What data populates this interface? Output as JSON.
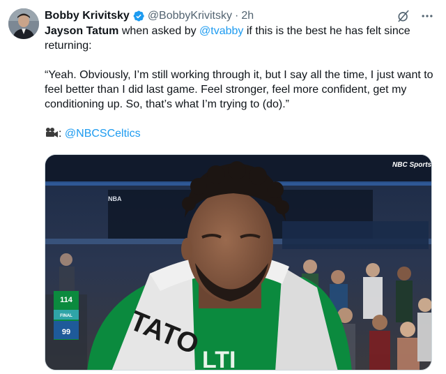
{
  "author": {
    "display_name": "Bobby Krivitsky",
    "handle": "@BobbyKrivitsky",
    "separator": "·",
    "time": "2h"
  },
  "tweet": {
    "line1_name": "Jayson Tatum",
    "line1_mid": " when asked by ",
    "line1_mention": "@tvabby",
    "line1_end": " if this is the best he has felt since returning:",
    "quote": "“Yeah. Obviously, I’m still working through it, but I say all the time, I just want to feel better than I did last game. Feel stronger, feel more confident, get my conditioning up. So, that’s what I’m trying to (do).”",
    "credit_suffix": ":",
    "credit_mention": "@NBCSCeltics"
  },
  "media": {
    "network_logo": "NBC Sports BOSTON",
    "banner_text": "NBA",
    "score_top": "114",
    "score_status": "FINAL",
    "score_bottom": "99",
    "towel_text": "TATO",
    "shirt_text": "LTI"
  },
  "icons": {
    "verified": "verified-badge-icon",
    "grok": "grok-icon",
    "more": "more-icon",
    "camera": "video-camera-icon"
  },
  "colors": {
    "link": "#1d9bf0",
    "verified": "#1d9bf0",
    "secondary_text": "#536471",
    "celtics_green": "#0b8a3e"
  }
}
